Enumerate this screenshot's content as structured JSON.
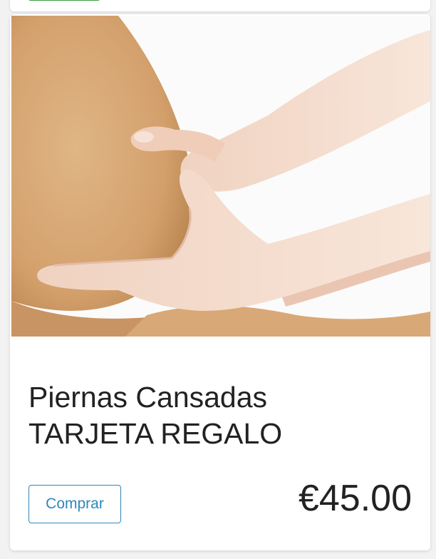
{
  "product": {
    "title_line1": "Piernas Cansadas",
    "title_line2": "TARJETA REGALO",
    "image_subject": "leg-massage-photo",
    "buy_label": "Comprar",
    "price": "€45.00"
  },
  "colors": {
    "accent": "#2f87b8",
    "badge_green": "#3f9b3f",
    "text": "#222222"
  }
}
